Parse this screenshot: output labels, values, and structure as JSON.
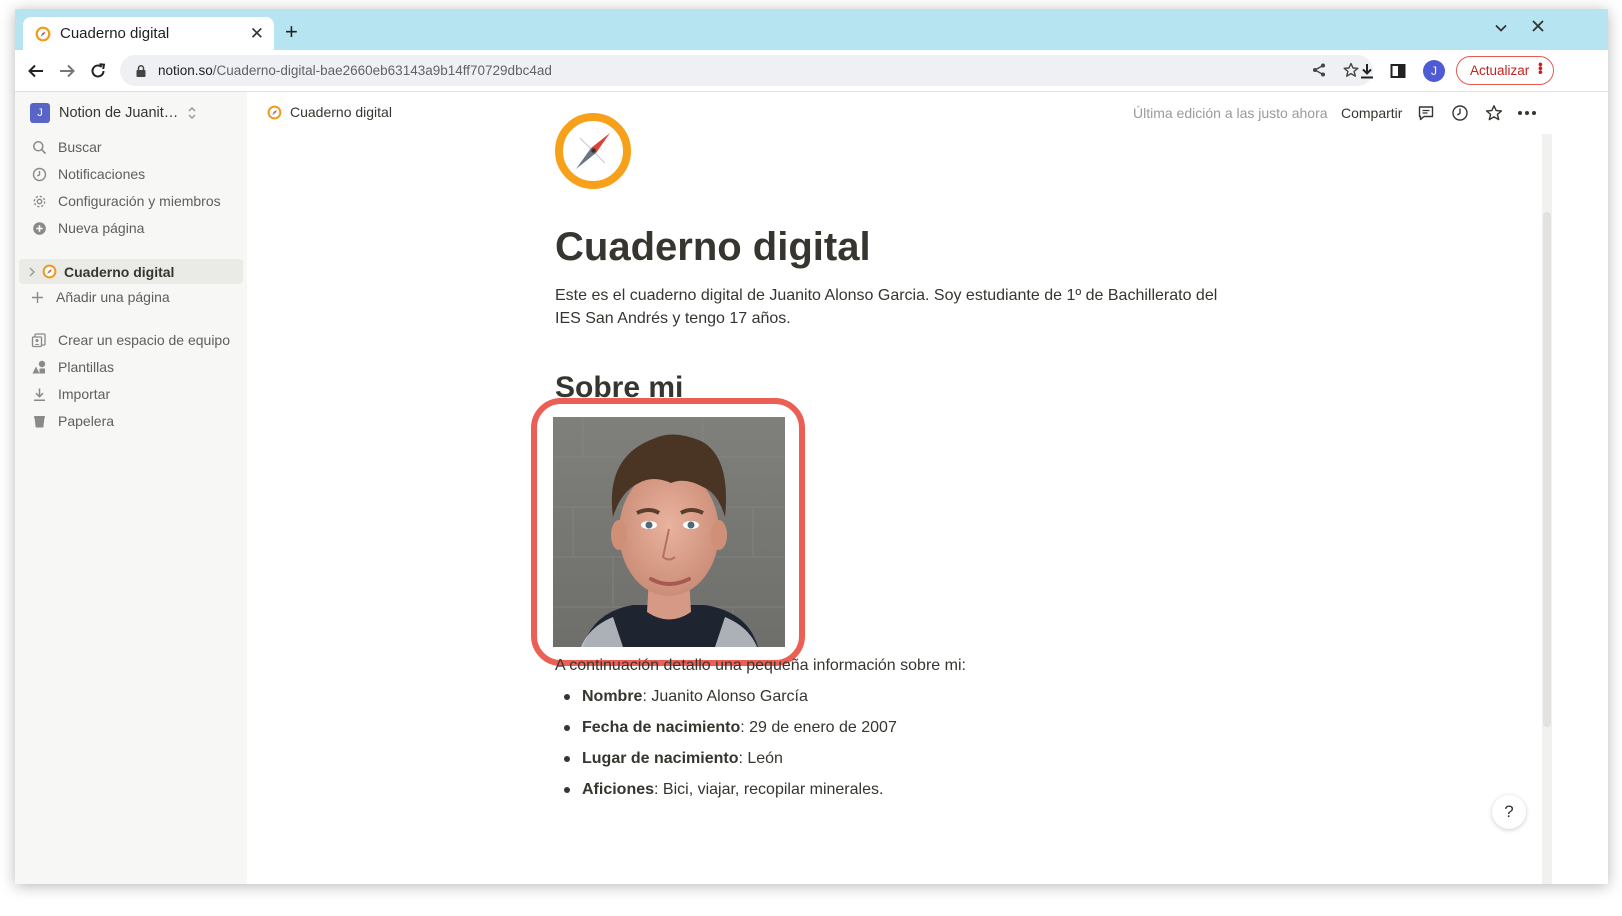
{
  "browser": {
    "tab_title": "Cuaderno digital",
    "new_tab": "+",
    "tab_close": "✕",
    "url_host": "notion.so",
    "url_path": "/Cuaderno-digital-bae2660eb63143a9b14ff70729dbc4ad",
    "profile_initial": "J",
    "update_label": "Actualizar"
  },
  "sidebar": {
    "workspace_initial": "J",
    "workspace_name": "Notion de Juanit…",
    "items": [
      {
        "label": "Buscar",
        "icon": "search-icon"
      },
      {
        "label": "Notificaciones",
        "icon": "clock-icon"
      },
      {
        "label": "Configuración y miembros",
        "icon": "gear-icon"
      },
      {
        "label": "Nueva página",
        "icon": "plus-circle-icon"
      }
    ],
    "page": "Cuaderno digital",
    "add_page": "Añadir una página",
    "bottom_items": [
      {
        "label": "Crear un espacio de equipo",
        "icon": "teamspace-icon"
      },
      {
        "label": "Plantillas",
        "icon": "shapes-icon"
      },
      {
        "label": "Importar",
        "icon": "download-icon"
      },
      {
        "label": "Papelera",
        "icon": "trash-icon"
      }
    ]
  },
  "topbar": {
    "breadcrumb": "Cuaderno digital",
    "edited": "Última edición a las justo ahora",
    "share": "Compartir"
  },
  "page": {
    "title": "Cuaderno digital",
    "intro": "Este es el cuaderno digital de Juanito Alonso Garcia. Soy estudiante de 1º de Bachillerato del IES San Andrés y tengo 17 años.",
    "section_heading": "Sobre mi",
    "info_intro": "A continuación detallo una pequeña información sobre mi:",
    "facts": [
      {
        "label": "Nombre",
        "value": ": Juanito Alonso García"
      },
      {
        "label": "Fecha de nacimiento",
        "value": ": 29 de enero de 2007"
      },
      {
        "label": "Lugar de nacimiento",
        "value": ": León"
      },
      {
        "label": "Aficiones",
        "value": ": Bici, viajar, recopilar minerales."
      }
    ]
  },
  "help_label": "?",
  "colors": {
    "tabstrip": "#b6e4f1",
    "sidebar": "#f7f7f5",
    "highlight": "#ec5f55",
    "brand": "#5864c7"
  }
}
